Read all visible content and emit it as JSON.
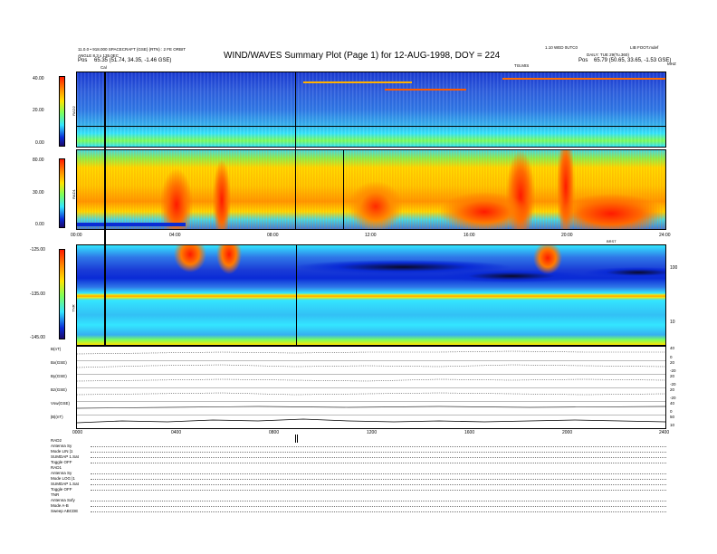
{
  "header": {
    "title": "WIND/WAVES Summary Plot (Page 1) for 12-AUG-1998, DOY = 224",
    "left_line1": "11.0.0 • 918.000 SPACECRAFT (GSE) (RTN) : 2 FE ORBIT",
    "left_line2": "ANGLE 8.3 x 135.0EC",
    "left_pos_label": "Pos",
    "left_pos_value": "65.35 (51.74, 34.35, -1.46 GSE)",
    "right_line1": "1.10 WED 0UTC0",
    "right_line2": "LIB FOOT.mdef",
    "right_line3": "DAILY: TUE 29(Tu.360)",
    "right_pos_label": "Pos",
    "right_pos_value": "65.79 (50.65, 33.65, -1.53 GSE)",
    "mhz_label": "MHZ",
    "top_marker": "TIS.MIS",
    "cal_marker": "Cal"
  },
  "rad2": {
    "label": "RAD2",
    "ticks": [
      "40.00",
      "20.00",
      "0.00"
    ]
  },
  "rad1": {
    "label": "RAD1",
    "ticks": [
      "80.00",
      "30.00",
      "0.00"
    ]
  },
  "time_axis": {
    "ticks": [
      "00:00",
      "04:00",
      "08:00",
      "12:00",
      "16:00",
      "20:00",
      "24:00"
    ],
    "mid_label": "BRST"
  },
  "tnr": {
    "label": "TNR",
    "ticks": [
      "-125.00",
      "-135.00",
      "-145.00"
    ],
    "right_ticks": [
      "100",
      "10"
    ]
  },
  "mag": {
    "rows": [
      {
        "label": "B(nT)",
        "right": [
          "40",
          "10",
          "0"
        ]
      },
      {
        "label": "Bx(GSE)",
        "right": [
          "20",
          "0",
          "-20"
        ]
      },
      {
        "label": "By(GSE)",
        "right": [
          "20",
          "0",
          "-20"
        ]
      },
      {
        "label": "Bz(GSE)",
        "right": [
          "20",
          "0",
          "-20"
        ]
      },
      {
        "label": "Vsw(GSE)",
        "right": [
          "40",
          "10",
          "0"
        ]
      },
      {
        "label": "|B|(nT)",
        "right": [
          "50",
          "20",
          "10"
        ]
      }
    ],
    "bottom_ticks": [
      "0000",
      "0400",
      "0800",
      "1200",
      "1600",
      "2000",
      "2400"
    ]
  },
  "status": {
    "rows": [
      "RAD2",
      "Antenna    Sy",
      "Mode    LIN |1",
      "SUMDAP 1.Sat",
      "Toggle    OFF",
      "RAD1",
      "Antenna    Sy",
      "Mode   LOG |1",
      "SUMDAP 1.Sat",
      "Toggle    OFF",
      "TNR",
      "Antenna   Sxfy",
      "Mode    A-B",
      "Sweep  ABCDE"
    ]
  },
  "colors": {
    "blue": "#0a2bd6",
    "cyan": "#33e6ff",
    "yellow": "#ffe400",
    "red": "#ff1a00",
    "dark": "#0a0a2a"
  }
}
